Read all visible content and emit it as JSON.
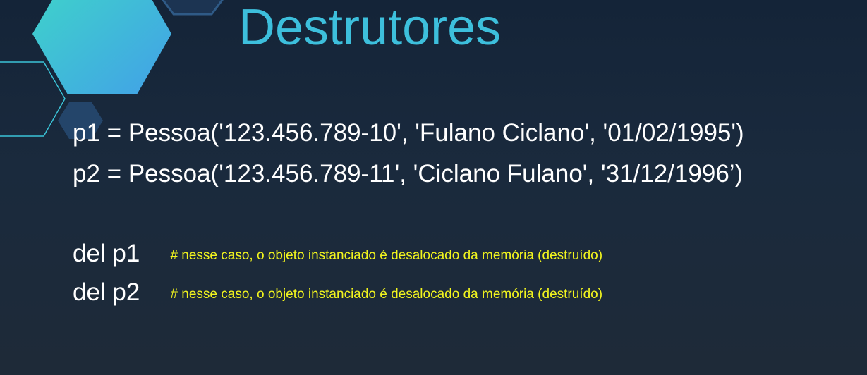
{
  "slide": {
    "title": "Destrutores",
    "code_lines": [
      "p1 = Pessoa('123.456.789-10', 'Fulano Ciclano', '01/02/1995')",
      "p2 = Pessoa('123.456.789-11', 'Ciclano Fulano', '31/12/1996’)"
    ],
    "del_statements": [
      {
        "code": "del p1",
        "comment": "# nesse caso, o objeto instanciado é desalocado da memória (destruído)"
      },
      {
        "code": "del p2",
        "comment": "# nesse caso, o objeto instanciado é desalocado da memória (destruído)"
      }
    ]
  },
  "colors": {
    "background": "#1a2a3d",
    "title": "#3dbfdc",
    "code_text": "#ffffff",
    "comment_text": "#f2f51e",
    "hexagon_gradient_start": "#3ed6c8",
    "hexagon_gradient_end": "#42a0e8",
    "hexagon_dark": "#24456a",
    "hexagon_outline": "#3bc4d8"
  }
}
